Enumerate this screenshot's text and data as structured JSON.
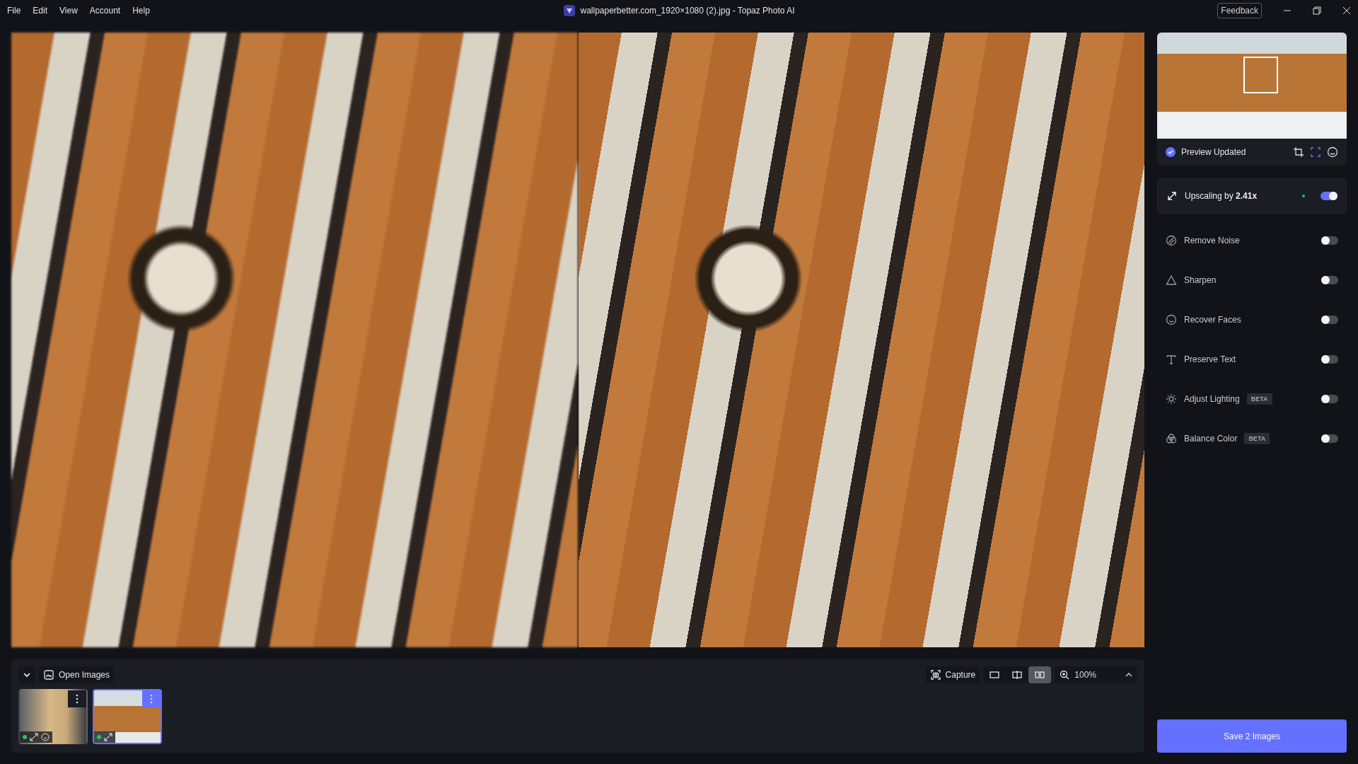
{
  "menu": [
    "File",
    "Edit",
    "View",
    "Account",
    "Help"
  ],
  "window": {
    "title": "wallpaperbetter.com_1920×1080 (2).jpg - Topaz Photo AI",
    "feedback": "Feedback"
  },
  "preview": {
    "status": "Preview Updated"
  },
  "filters": [
    {
      "kind": "upscale",
      "label": "Upscaling by **2.41x**",
      "on": true
    },
    {
      "kind": "noise",
      "label": "Remove Noise",
      "on": false
    },
    {
      "kind": "sharpen",
      "label": "Sharpen",
      "on": false
    },
    {
      "kind": "faces",
      "label": "Recover Faces",
      "on": false
    },
    {
      "kind": "text",
      "label": "Preserve Text",
      "on": false
    },
    {
      "kind": "lighting",
      "label": "Adjust Lighting",
      "badge": "BETA",
      "on": false
    },
    {
      "kind": "color",
      "label": "Balance Color",
      "badge": "BETA",
      "on": false
    }
  ],
  "filmstrip": {
    "title": "Open Images",
    "thumbnails": [
      {
        "kind": "person",
        "selected": false
      },
      {
        "kind": "tiger",
        "selected": true
      }
    ]
  },
  "toolbar": {
    "capture": "Capture",
    "views": [
      {
        "kind": "single",
        "selected": false
      },
      {
        "kind": "split",
        "selected": false
      },
      {
        "kind": "side",
        "selected": true
      }
    ],
    "zoom": "100%"
  },
  "save": "Save 2 Images"
}
